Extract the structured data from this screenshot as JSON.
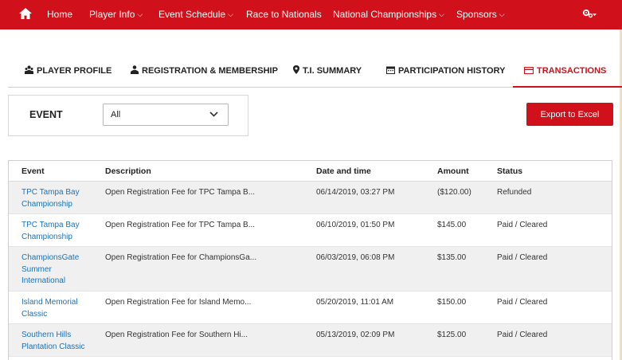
{
  "nav": {
    "items": [
      {
        "label": "Home",
        "dropdown": false
      },
      {
        "label": "Player Info",
        "dropdown": true
      },
      {
        "label": "Event Schedule",
        "dropdown": true
      },
      {
        "label": "Race to Nationals",
        "dropdown": false
      },
      {
        "label": "National Championships",
        "dropdown": true
      },
      {
        "label": "Sponsors",
        "dropdown": true
      }
    ],
    "chevron": "⌄",
    "accent": "#d0111b"
  },
  "tabs": [
    {
      "label": "PLAYER PROFILE",
      "icon": "players-icon"
    },
    {
      "label": "REGISTRATION & MEMBERSHIP",
      "icon": "person-icon"
    },
    {
      "label": "T.I. SUMMARY",
      "icon": "map-pin-icon"
    },
    {
      "label": "PARTICIPATION HISTORY",
      "icon": "calendar-icon"
    },
    {
      "label": "TRANSACTIONS",
      "icon": "credit-card-icon",
      "active": true
    }
  ],
  "filter": {
    "label": "EVENT",
    "selected": "All"
  },
  "export_label": "Export to Excel",
  "table": {
    "headers": [
      "Event",
      "Description",
      "Date and time",
      "Amount",
      "Status"
    ],
    "rows": [
      {
        "event": [
          "TPC Tampa Bay",
          "Championship"
        ],
        "description": "Open Registration Fee for TPC Tampa B...",
        "datetime": "06/14/2019, 03:27 PM",
        "amount": "($120.00)",
        "status": "Refunded"
      },
      {
        "event": [
          "TPC Tampa Bay",
          "Championship"
        ],
        "description": "Open Registration Fee for TPC Tampa B...",
        "datetime": "06/10/2019, 01:50 PM",
        "amount": "$145.00",
        "status": "Paid / Cleared"
      },
      {
        "event": [
          "ChampionsGate",
          "Summer",
          "International"
        ],
        "description": "Open Registration Fee for ChampionsGa...",
        "datetime": "06/03/2019, 06:08 PM",
        "amount": "$135.00",
        "status": "Paid / Cleared"
      },
      {
        "event": [
          "Island Memorial",
          "Classic"
        ],
        "description": "Open Registration Fee for Island Memo...",
        "datetime": "05/20/2019, 11:01 AM",
        "amount": "$150.00",
        "status": "Paid / Cleared"
      },
      {
        "event": [
          "Southern Hills",
          "Plantation Classic"
        ],
        "description": "Open Registration Fee for Southern Hi...",
        "datetime": "05/13/2019, 02:09 PM",
        "amount": "$125.00",
        "status": "Paid / Cleared"
      }
    ]
  }
}
